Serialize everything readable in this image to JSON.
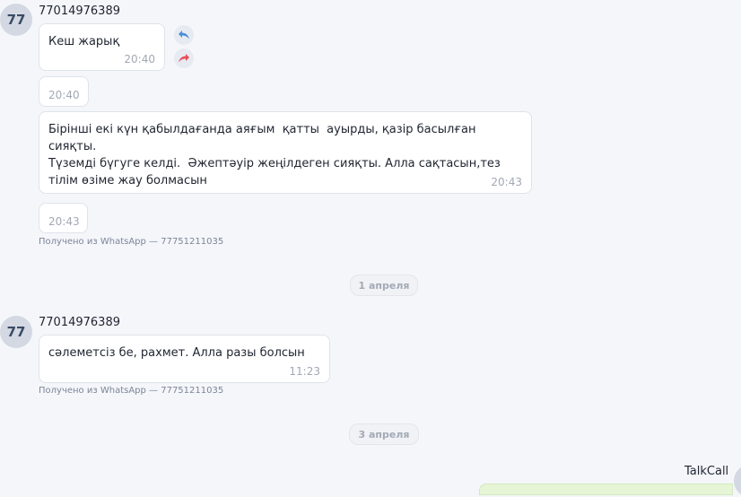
{
  "conversation": {
    "message_groups": [
      {
        "avatar_initials": "77",
        "sender": "77014976389",
        "messages": [
          {
            "text": "Кеш жарық",
            "time": "20:40"
          },
          {
            "text": "",
            "time": "20:40"
          },
          {
            "text": "Бірінші екі күн қабылдағанда аяғым  қатты  ауырды, қазір басылған сияқты.\nТүземді бүгуге келді.  Әжептәуір жеңілдеген сияқты. Алла сақтасын,тез тілім өзіме жау болмасын",
            "time": "20:43"
          },
          {
            "text": "",
            "time": "20:43"
          }
        ],
        "source": "Получено из WhatsApp — 77751211035"
      },
      {
        "avatar_initials": "77",
        "sender": "77014976389",
        "messages": [
          {
            "text": "сәлеметсіз бе, рахмет. Алла разы болсын",
            "time": "11:23"
          }
        ],
        "source": "Получено из WhatsApp — 77751211035"
      }
    ],
    "date_separators": [
      "1 апреля",
      "3 апреля"
    ],
    "outgoing": {
      "sender": "TalkCall"
    }
  },
  "icons": {
    "reply": "reply-icon",
    "forward": "forward-icon"
  },
  "colors": {
    "background": "#f4f6fa",
    "bubble": "#ffffff",
    "outgoing_bubble": "#e6f5d6",
    "reply_icon": "#4a90d9",
    "forward_icon": "#e8505b",
    "avatar": "#d3d8e3"
  }
}
